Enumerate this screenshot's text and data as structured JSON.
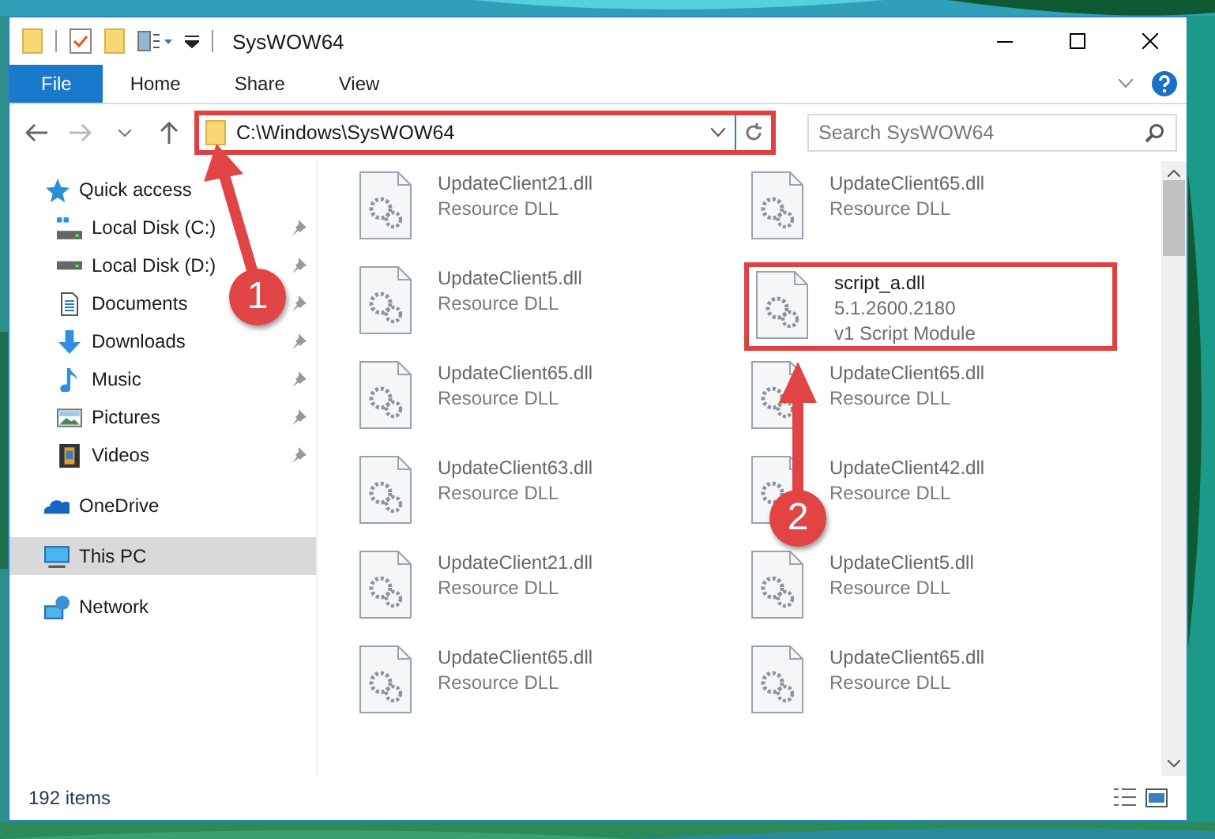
{
  "window": {
    "title": "SysWOW64"
  },
  "ribbon": {
    "tabs": [
      {
        "label": "File",
        "kind": "file",
        "selected": false
      },
      {
        "label": "Home",
        "kind": "tab",
        "selected": false
      },
      {
        "label": "Share",
        "kind": "tab",
        "selected": false
      },
      {
        "label": "View",
        "kind": "tab",
        "selected": false
      }
    ]
  },
  "address_bar": {
    "path": "C:\\Windows\\SysWOW64",
    "highlighted": true
  },
  "search": {
    "placeholder": "Search SysWOW64"
  },
  "sidebar": {
    "items": [
      {
        "label": "Quick access",
        "kind": "star",
        "selected": false,
        "children": [
          {
            "label": "Local Disk (C:)",
            "kind": "system-drive",
            "selected": false,
            "pinned": true
          },
          {
            "label": "Local Disk (D:)",
            "kind": "drive",
            "selected": false,
            "pinned": true
          },
          {
            "label": "Documents",
            "kind": "documents",
            "selected": false,
            "pinned": true
          },
          {
            "label": "Downloads",
            "kind": "downloads",
            "selected": false,
            "pinned": true
          },
          {
            "label": "Music",
            "kind": "music",
            "selected": false,
            "pinned": true
          },
          {
            "label": "Pictures",
            "kind": "pictures",
            "selected": false,
            "pinned": true
          },
          {
            "label": "Videos",
            "kind": "videos",
            "selected": false,
            "pinned": true
          }
        ]
      },
      {
        "label": "OneDrive",
        "kind": "cloud",
        "selected": false
      },
      {
        "label": "This PC",
        "kind": "computer",
        "selected": true
      },
      {
        "label": "Network",
        "kind": "network",
        "selected": false
      }
    ]
  },
  "files": [
    {
      "name": "UpdateClient21.dll",
      "details": [
        "Resource DLL"
      ],
      "faded": true,
      "highlighted": false
    },
    {
      "name": "UpdateClient65.dll",
      "details": [
        "Resource DLL"
      ],
      "faded": true,
      "highlighted": false
    },
    {
      "name": "UpdateClient5.dll",
      "details": [
        "Resource DLL"
      ],
      "faded": true,
      "highlighted": false
    },
    {
      "name": "script_a.dll",
      "details": [
        "5.1.2600.2180",
        "v1 Script Module"
      ],
      "faded": false,
      "highlighted": true
    },
    {
      "name": "UpdateClient65.dll",
      "details": [
        "Resource DLL"
      ],
      "faded": true,
      "highlighted": false
    },
    {
      "name": "UpdateClient65.dll",
      "details": [
        "Resource DLL"
      ],
      "faded": true,
      "highlighted": false
    },
    {
      "name": "UpdateClient63.dll",
      "details": [
        "Resource DLL"
      ],
      "faded": true,
      "highlighted": false
    },
    {
      "name": "UpdateClient42.dll",
      "details": [
        "Resource DLL"
      ],
      "faded": true,
      "highlighted": false
    },
    {
      "name": "UpdateClient21.dll",
      "details": [
        "Resource DLL"
      ],
      "faded": true,
      "highlighted": false
    },
    {
      "name": "UpdateClient5.dll",
      "details": [
        "Resource DLL"
      ],
      "faded": true,
      "highlighted": false
    },
    {
      "name": "UpdateClient65.dll",
      "details": [
        "Resource DLL"
      ],
      "faded": true,
      "highlighted": false
    },
    {
      "name": "UpdateClient65.dll",
      "details": [
        "Resource DLL"
      ],
      "faded": true,
      "highlighted": false
    }
  ],
  "status_bar": {
    "count": "192 items"
  },
  "annotations": [
    {
      "label": "1"
    },
    {
      "label": "2"
    }
  ]
}
